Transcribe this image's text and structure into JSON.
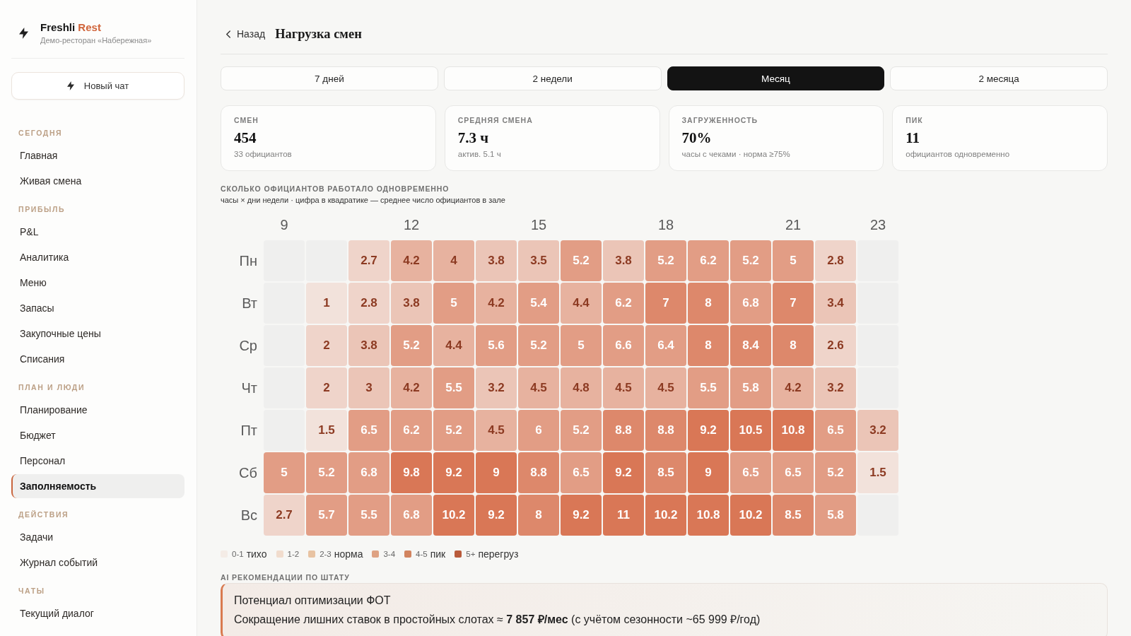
{
  "sidebar": {
    "brand": {
      "name": "Freshli",
      "accent": "Rest",
      "subtitle": "Демо-ресторан «Набережная»"
    },
    "new_chat": "Новый чат",
    "sections": [
      {
        "title": "СЕГОДНЯ",
        "items": [
          {
            "label": "Главная",
            "selected": false
          },
          {
            "label": "Живая смена",
            "selected": false
          }
        ]
      },
      {
        "title": "ПРИБЫЛЬ",
        "items": [
          {
            "label": "P&L",
            "selected": false
          },
          {
            "label": "Аналитика",
            "selected": false
          },
          {
            "label": "Меню",
            "selected": false
          },
          {
            "label": "Запасы",
            "selected": false
          },
          {
            "label": "Закупочные цены",
            "selected": false
          },
          {
            "label": "Списания",
            "selected": false
          }
        ]
      },
      {
        "title": "ПЛАН И ЛЮДИ",
        "items": [
          {
            "label": "Планирование",
            "selected": false
          },
          {
            "label": "Бюджет",
            "selected": false
          },
          {
            "label": "Персонал",
            "selected": false
          },
          {
            "label": "Заполняемость",
            "selected": true
          }
        ]
      },
      {
        "title": "ДЕЙСТВИЯ",
        "items": [
          {
            "label": "Задачи",
            "selected": false
          },
          {
            "label": "Журнал событий",
            "selected": false
          }
        ]
      },
      {
        "title": "ЧАТЫ",
        "items": [
          {
            "label": "Текущий диалог",
            "selected": false
          }
        ]
      }
    ]
  },
  "header": {
    "back": "Назад",
    "title": "Нагрузка смен"
  },
  "tabs": [
    {
      "label": "7 дней",
      "selected": false
    },
    {
      "label": "2 недели",
      "selected": false
    },
    {
      "label": "Месяц",
      "selected": true
    },
    {
      "label": "2 месяца",
      "selected": false
    }
  ],
  "stats": [
    {
      "label": "СМЕН",
      "value": "454",
      "note": "33 официантов"
    },
    {
      "label": "СРЕДНЯЯ СМЕНА",
      "value": "7.3 ч",
      "note": "актив. 5.1 ч"
    },
    {
      "label": "ЗАГРУЖЕННОСТЬ",
      "value": "70%",
      "note": "часы с чеками · норма ≥75%"
    },
    {
      "label": "ПИК",
      "value": "11",
      "note": "официантов одновременно"
    }
  ],
  "heatmap": {
    "title": "СКОЛЬКО ОФИЦИАНТОВ РАБОТАЛО ОДНОВРЕМЕННО",
    "subtitle": "часы × дни недели · цифра в квадратике — среднее число официантов в зале",
    "hour_labels": [
      "9",
      "12",
      "15",
      "18",
      "21",
      "23"
    ],
    "rows": [
      {
        "day": "Пн",
        "cells": [
          {
            "kind": "empty"
          },
          {
            "kind": "empty"
          },
          {
            "kind": "value",
            "value": "2.7"
          },
          {
            "kind": "value",
            "value": "4.2"
          },
          {
            "kind": "value",
            "value": "4"
          },
          {
            "kind": "value",
            "value": "3.8"
          },
          {
            "kind": "value",
            "value": "3.5"
          },
          {
            "kind": "value",
            "value": "5.2"
          },
          {
            "kind": "value",
            "value": "3.8"
          },
          {
            "kind": "value",
            "value": "5.2"
          },
          {
            "kind": "value",
            "value": "6.2"
          },
          {
            "kind": "value",
            "value": "5.2"
          },
          {
            "kind": "value",
            "value": "5"
          },
          {
            "kind": "value",
            "value": "2.8"
          },
          {
            "kind": "empty"
          }
        ]
      },
      {
        "day": "Вт",
        "cells": [
          {
            "kind": "empty"
          },
          {
            "kind": "value",
            "value": "1"
          },
          {
            "kind": "value",
            "value": "2.8"
          },
          {
            "kind": "value",
            "value": "3.8"
          },
          {
            "kind": "value",
            "value": "5"
          },
          {
            "kind": "value",
            "value": "4.2"
          },
          {
            "kind": "value",
            "value": "5.4"
          },
          {
            "kind": "value",
            "value": "4.4"
          },
          {
            "kind": "value",
            "value": "6.2"
          },
          {
            "kind": "value",
            "value": "7"
          },
          {
            "kind": "value",
            "value": "8"
          },
          {
            "kind": "value",
            "value": "6.8"
          },
          {
            "kind": "value",
            "value": "7"
          },
          {
            "kind": "value",
            "value": "3.4"
          },
          {
            "kind": "empty"
          }
        ]
      },
      {
        "day": "Ср",
        "cells": [
          {
            "kind": "empty"
          },
          {
            "kind": "value",
            "value": "2"
          },
          {
            "kind": "value",
            "value": "3.8"
          },
          {
            "kind": "value",
            "value": "5.2"
          },
          {
            "kind": "value",
            "value": "4.4"
          },
          {
            "kind": "value",
            "value": "5.6"
          },
          {
            "kind": "value",
            "value": "5.2"
          },
          {
            "kind": "value",
            "value": "5"
          },
          {
            "kind": "value",
            "value": "6.6"
          },
          {
            "kind": "value",
            "value": "6.4"
          },
          {
            "kind": "value",
            "value": "8"
          },
          {
            "kind": "value",
            "value": "8.4"
          },
          {
            "kind": "value",
            "value": "8"
          },
          {
            "kind": "value",
            "value": "2.6"
          },
          {
            "kind": "empty"
          }
        ]
      },
      {
        "day": "Чт",
        "cells": [
          {
            "kind": "empty"
          },
          {
            "kind": "value",
            "value": "2"
          },
          {
            "kind": "value",
            "value": "3"
          },
          {
            "kind": "value",
            "value": "4.2"
          },
          {
            "kind": "value",
            "value": "5.5"
          },
          {
            "kind": "value",
            "value": "3.2"
          },
          {
            "kind": "value",
            "value": "4.5"
          },
          {
            "kind": "value",
            "value": "4.8"
          },
          {
            "kind": "value",
            "value": "4.5"
          },
          {
            "kind": "value",
            "value": "4.5"
          },
          {
            "kind": "value",
            "value": "5.5"
          },
          {
            "kind": "value",
            "value": "5.8"
          },
          {
            "kind": "value",
            "value": "4.2"
          },
          {
            "kind": "value",
            "value": "3.2"
          },
          {
            "kind": "empty"
          }
        ]
      },
      {
        "day": "Пт",
        "cells": [
          {
            "kind": "empty"
          },
          {
            "kind": "value",
            "value": "1.5"
          },
          {
            "kind": "value",
            "value": "6.5"
          },
          {
            "kind": "value",
            "value": "6.2"
          },
          {
            "kind": "value",
            "value": "5.2"
          },
          {
            "kind": "value",
            "value": "4.5"
          },
          {
            "kind": "value",
            "value": "6"
          },
          {
            "kind": "value",
            "value": "5.2"
          },
          {
            "kind": "value",
            "value": "8.8"
          },
          {
            "kind": "value",
            "value": "8.8"
          },
          {
            "kind": "value",
            "value": "9.2"
          },
          {
            "kind": "value",
            "value": "10.5"
          },
          {
            "kind": "value",
            "value": "10.8"
          },
          {
            "kind": "value",
            "value": "6.5"
          },
          {
            "kind": "value",
            "value": "3.2"
          }
        ]
      },
      {
        "day": "Сб",
        "cells": [
          {
            "kind": "value",
            "value": "5"
          },
          {
            "kind": "value",
            "value": "5.2"
          },
          {
            "kind": "value",
            "value": "6.8"
          },
          {
            "kind": "value",
            "value": "9.8"
          },
          {
            "kind": "value",
            "value": "9.2"
          },
          {
            "kind": "value",
            "value": "9"
          },
          {
            "kind": "value",
            "value": "8.8"
          },
          {
            "kind": "value",
            "value": "6.5"
          },
          {
            "kind": "value",
            "value": "9.2"
          },
          {
            "kind": "value",
            "value": "8.5"
          },
          {
            "kind": "value",
            "value": "9"
          },
          {
            "kind": "value",
            "value": "6.5"
          },
          {
            "kind": "value",
            "value": "6.5"
          },
          {
            "kind": "value",
            "value": "5.2"
          },
          {
            "kind": "value",
            "value": "1.5"
          }
        ]
      },
      {
        "day": "Вс",
        "cells": [
          {
            "kind": "value",
            "value": "2.7"
          },
          {
            "kind": "value",
            "value": "5.7"
          },
          {
            "kind": "value",
            "value": "5.5"
          },
          {
            "kind": "value",
            "value": "6.8"
          },
          {
            "kind": "value",
            "value": "10.2"
          },
          {
            "kind": "value",
            "value": "9.2"
          },
          {
            "kind": "value",
            "value": "8"
          },
          {
            "kind": "value",
            "value": "9.2"
          },
          {
            "kind": "value",
            "value": "11"
          },
          {
            "kind": "value",
            "value": "10.2"
          },
          {
            "kind": "value",
            "value": "10.8"
          },
          {
            "kind": "value",
            "value": "10.2"
          },
          {
            "kind": "value",
            "value": "8.5"
          },
          {
            "kind": "value",
            "value": "5.8"
          },
          {
            "kind": "empty"
          }
        ]
      }
    ],
    "legend": [
      {
        "range": "0-1",
        "label": "тихо",
        "color": "#f4ece6"
      },
      {
        "range": "1-2",
        "color": "#f1dccd"
      },
      {
        "range": "2-3",
        "label": "норма",
        "color": "#e8c3a2"
      },
      {
        "range": "3-4",
        "color": "#dea283"
      },
      {
        "range": "4-5",
        "label": "пик",
        "color": "#d2845f"
      },
      {
        "range": "5+",
        "label": "перегруз",
        "color": "#b95b3b"
      }
    ]
  },
  "recommendations": {
    "heading": "AI РЕКОМЕНДАЦИИ ПО ШТАТУ",
    "items": [
      {
        "title": "Потенциал оптимизации ФОТ",
        "text": "Сокращение лишних ставок в простойных слотах ≈ **7 857 ₽/мес** (с учётом сезонности ~65 999 ₽/год)"
      }
    ]
  }
}
